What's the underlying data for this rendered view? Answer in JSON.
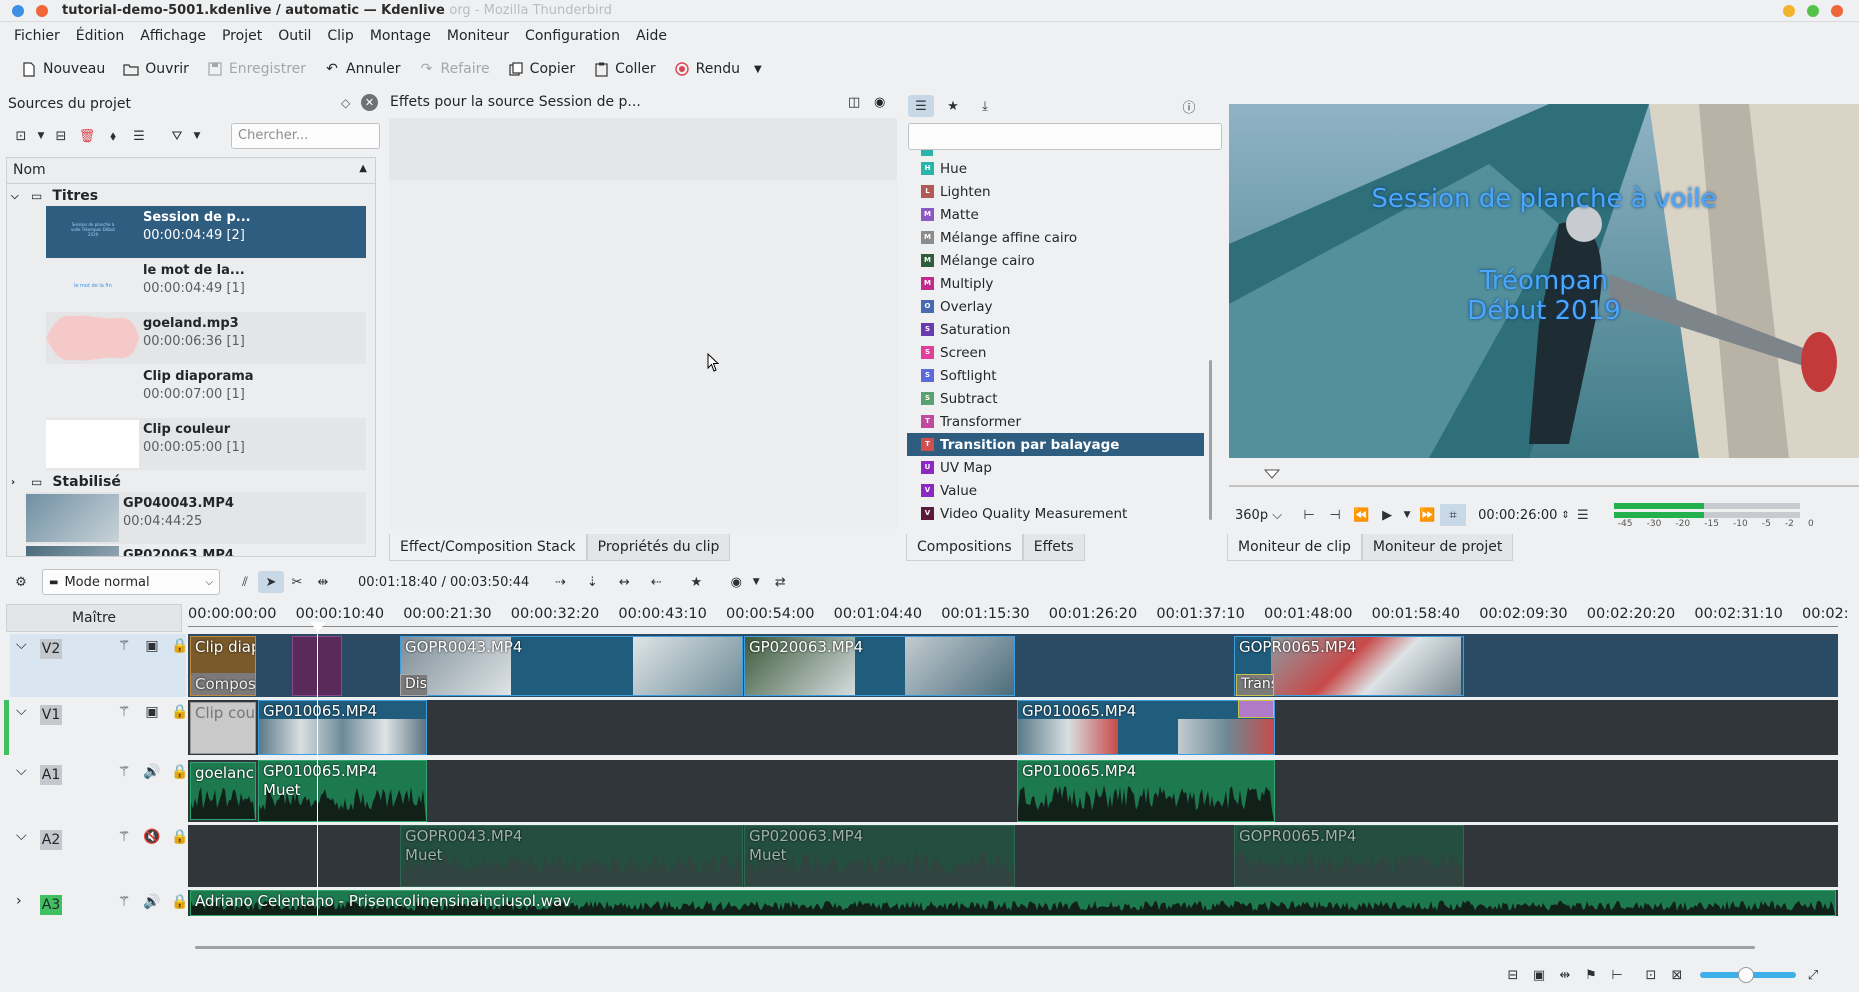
{
  "window": {
    "title": "tutorial-demo-5001.kdenlive / automatic — Kdenlive",
    "title_ghost": "org - Mozilla Thunderbird"
  },
  "menu": [
    "Fichier",
    "Édition",
    "Affichage",
    "Projet",
    "Outil",
    "Clip",
    "Montage",
    "Moniteur",
    "Configuration",
    "Aide"
  ],
  "toolbar": {
    "new": "Nouveau",
    "open": "Ouvrir",
    "save": "Enregistrer",
    "undo": "Annuler",
    "redo": "Refaire",
    "copy": "Copier",
    "paste": "Coller",
    "render": "Rendu"
  },
  "bin": {
    "title": "Sources du projet",
    "search_placeholder": "Chercher...",
    "column": "Nom",
    "folder_titles": "Titres",
    "folder_stab": "Stabilisé",
    "clips": [
      {
        "name": "Session de p...",
        "duration": "00:00:04:49 [2]",
        "thumb_text": "Session de planche à voile Tréompan Début 2019"
      },
      {
        "name": "le mot de la...",
        "duration": "00:00:04:49 [1]",
        "thumb_text": "le mot de la fin"
      },
      {
        "name": "goeland.mp3",
        "duration": "00:00:06:36 [1]"
      },
      {
        "name": "Clip diaporama",
        "duration": "00:00:07:00 [1]"
      },
      {
        "name": "Clip couleur",
        "duration": "00:00:05:00 [1]"
      }
    ],
    "stab_clips": [
      {
        "name": "GP040043.MP4",
        "duration": "00:04:44:25"
      },
      {
        "name": "GP020063.MP4",
        "duration": ""
      }
    ]
  },
  "effect_stack": {
    "title": "Effets pour la source Session de p..."
  },
  "effects": {
    "items": [
      {
        "label": "Hue",
        "badge": "H",
        "color": "#2bb5a8"
      },
      {
        "label": "Lighten",
        "badge": "L",
        "color": "#b05a5a"
      },
      {
        "label": "Matte",
        "badge": "M",
        "color": "#8a5ac0"
      },
      {
        "label": "Mélange affine cairo",
        "badge": "M",
        "color": "#8c8c8c"
      },
      {
        "label": "Mélange cairo",
        "badge": "M",
        "color": "#2f5d3a"
      },
      {
        "label": "Multiply",
        "badge": "M",
        "color": "#c02a8a"
      },
      {
        "label": "Overlay",
        "badge": "O",
        "color": "#4a6ab0"
      },
      {
        "label": "Saturation",
        "badge": "S",
        "color": "#6a3ab0"
      },
      {
        "label": "Screen",
        "badge": "S",
        "color": "#e0409a"
      },
      {
        "label": "Softlight",
        "badge": "S",
        "color": "#5a6ad8"
      },
      {
        "label": "Subtract",
        "badge": "S",
        "color": "#5aa070"
      },
      {
        "label": "Transformer",
        "badge": "T",
        "color": "#c04aa0"
      },
      {
        "label": "Transition par balayage",
        "badge": "T",
        "color": "#d05050"
      },
      {
        "label": "UV Map",
        "badge": "U",
        "color": "#8a2ac0"
      },
      {
        "label": "Value",
        "badge": "V",
        "color": "#8a2ac0"
      },
      {
        "label": "Video Quality Measurement",
        "badge": "V",
        "color": "#5a1a3a"
      }
    ]
  },
  "monitor": {
    "overlay_line1": "Session de planche à voile",
    "overlay_line2": "Tréompan",
    "overlay_line3": "Début 2019",
    "resolution": "360p",
    "timecode": "00:00:26:00",
    "vu_labels": [
      "-45",
      "-30",
      "-20",
      "-15",
      "-10",
      "-5",
      "-2",
      "0"
    ]
  },
  "tabs": {
    "left": [
      "Effect/Composition Stack",
      "Propriétés du clip"
    ],
    "mid": [
      "Compositions",
      "Effets"
    ],
    "right": [
      "Moniteur de clip",
      "Moniteur de projet"
    ]
  },
  "timeline": {
    "mode": "Mode normal",
    "position": "00:01:18:40 / 00:03:50:44",
    "master": "Maître",
    "ruler": [
      "00:00:00:00",
      "00:00:10:40",
      "00:00:21:30",
      "00:00:32:20",
      "00:00:43:10",
      "00:00:54:00",
      "00:01:04:40",
      "00:01:15:30",
      "00:01:26:20",
      "00:01:37:10",
      "00:01:48:00",
      "00:01:58:40",
      "00:02:09:30",
      "00:02:20:20",
      "00:02:31:10",
      "00:02:"
    ],
    "tracks": [
      "V2",
      "V1",
      "A1",
      "A2",
      "A3"
    ],
    "clips": {
      "v2_a": "Clip diap",
      "v2_a2": "Compos",
      "v2_b": "GOPR0043.MP4",
      "v2_c": "GP020063.MP4",
      "v2_d": "GOPR0065.MP4",
      "v2_dis": "Dis",
      "v2_trans": "Trans",
      "v1_a": "Clip cou",
      "v1_b": "GP010065.MP4",
      "v1_c": "GP010065.MP4",
      "a1_a": "goelanc",
      "a1_b": "GP010065.MP4",
      "a1_b2": "Muet",
      "a1_c": "GP010065.MP4",
      "a2_a": "GOPR0043.MP4",
      "a2_a2": "Muet",
      "a2_b": "GP020063.MP4",
      "a2_b2": "Muet",
      "a2_c": "GOPR0065.MP4",
      "a3_a": "Adriano Celentano - Prisencolinensinainciusol.wav"
    }
  }
}
